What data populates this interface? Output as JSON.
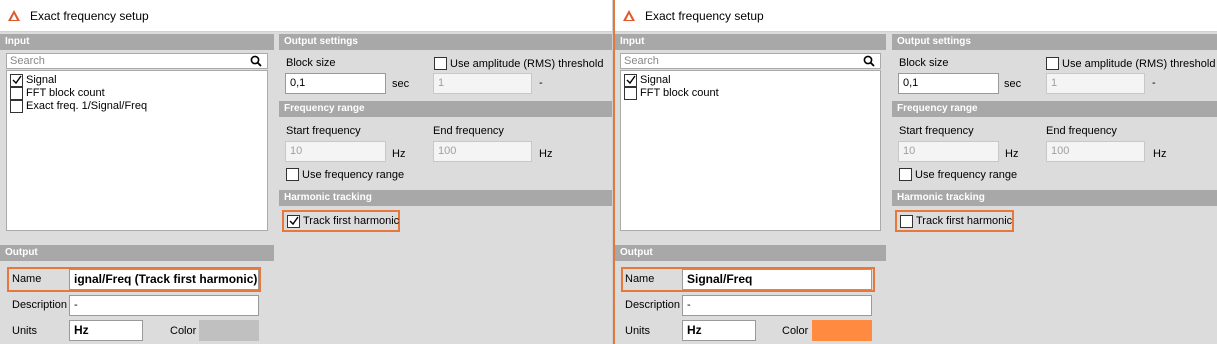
{
  "left": {
    "title": "Exact frequency setup",
    "input": {
      "header": "Input",
      "search_placeholder": "Search",
      "items": [
        {
          "label": "Signal",
          "checked": true
        },
        {
          "label": "FFT block count",
          "checked": false
        },
        {
          "label": "Exact freq. 1/Signal/Freq",
          "checked": false
        }
      ]
    },
    "output": {
      "header": "Output",
      "name_label": "Name",
      "name_value": "ignal/Freq (Track first harmonic)",
      "description_label": "Description",
      "description_value": "-",
      "units_label": "Units",
      "units_value": "Hz",
      "color_label": "Color",
      "color_value": "#c0c0c0"
    },
    "output_settings": {
      "header": "Output settings",
      "block_size_label": "Block size",
      "block_size_value": "0,1",
      "block_size_unit": "sec",
      "use_threshold_label": "Use amplitude (RMS) threshold",
      "use_threshold_checked": false,
      "threshold_value": "1",
      "threshold_unit": "-"
    },
    "frequency_range": {
      "header": "Frequency range",
      "start_label": "Start frequency",
      "start_value": "10",
      "start_unit": "Hz",
      "end_label": "End frequency",
      "end_value": "100",
      "end_unit": "Hz",
      "use_range_label": "Use frequency range",
      "use_range_checked": false
    },
    "harmonic_tracking": {
      "header": "Harmonic tracking",
      "track_label": "Track first harmonic",
      "track_checked": true
    }
  },
  "right": {
    "title": "Exact frequency setup",
    "input": {
      "header": "Input",
      "search_placeholder": "Search",
      "items": [
        {
          "label": "Signal",
          "checked": true
        },
        {
          "label": "FFT block count",
          "checked": false
        }
      ]
    },
    "output": {
      "header": "Output",
      "name_label": "Name",
      "name_value": "Signal/Freq",
      "description_label": "Description",
      "description_value": "-",
      "units_label": "Units",
      "units_value": "Hz",
      "color_label": "Color",
      "color_value": "#ff8a40"
    },
    "output_settings": {
      "header": "Output settings",
      "block_size_label": "Block size",
      "block_size_value": "0,1",
      "block_size_unit": "sec",
      "use_threshold_label": "Use amplitude (RMS) threshold",
      "use_threshold_checked": false,
      "threshold_value": "1",
      "threshold_unit": "-"
    },
    "frequency_range": {
      "header": "Frequency range",
      "start_label": "Start frequency",
      "start_value": "10",
      "start_unit": "Hz",
      "end_label": "End frequency",
      "end_value": "100",
      "end_unit": "Hz",
      "use_range_label": "Use frequency range",
      "use_range_checked": false
    },
    "harmonic_tracking": {
      "header": "Harmonic tracking",
      "track_label": "Track first harmonic",
      "track_checked": false
    }
  },
  "colors": {
    "highlight": "#e8783a",
    "section_header": "#a8a8a8",
    "panel_bg": "#dcdcdc"
  }
}
